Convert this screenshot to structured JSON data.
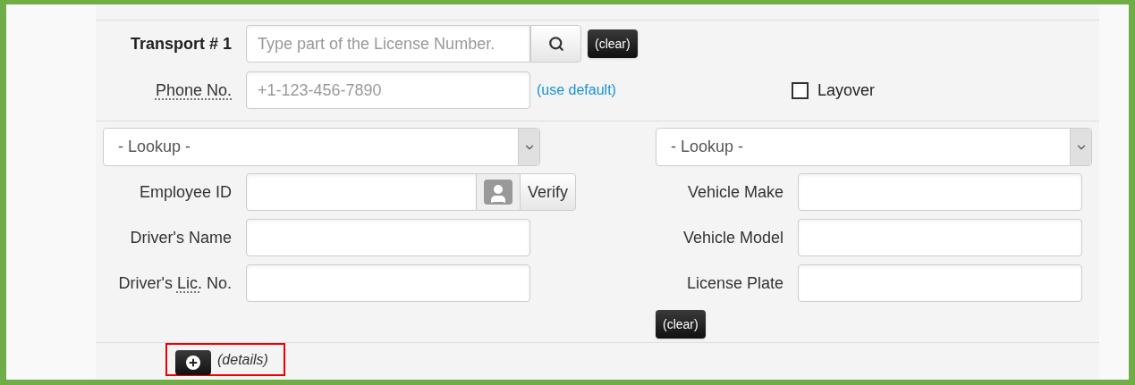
{
  "transport": {
    "label": "Transport # 1",
    "search_placeholder": "Type part of the License Number.",
    "clear": "(clear)"
  },
  "phone": {
    "label": "Phone No.",
    "placeholder": "+1-123-456-7890",
    "link": "(use default)"
  },
  "layover": {
    "label": "Layover",
    "checked": false
  },
  "driver": {
    "lookup": "- Lookup -",
    "fields": [
      {
        "kind": "verify",
        "label_parts": [
          {
            "text": "Employee ID",
            "abbr": false
          }
        ],
        "button": "Verify"
      },
      {
        "kind": "plain",
        "label_parts": [
          {
            "text": "Driver's Name",
            "abbr": false
          }
        ]
      },
      {
        "kind": "plain",
        "label_parts": [
          {
            "text": "Driver's ",
            "abbr": false
          },
          {
            "text": "Lic.",
            "abbr": true
          },
          {
            "text": " No.",
            "abbr": false
          }
        ]
      }
    ]
  },
  "vehicle": {
    "lookup": "- Lookup -",
    "fields": [
      {
        "kind": "plain",
        "label_parts": [
          {
            "text": "Vehicle Make",
            "abbr": false
          }
        ]
      },
      {
        "kind": "plain",
        "label_parts": [
          {
            "text": "Vehicle Model",
            "abbr": false
          }
        ]
      },
      {
        "kind": "plain",
        "label_parts": [
          {
            "text": "License Plate",
            "abbr": false
          }
        ]
      }
    ],
    "clear": "(clear)"
  },
  "details": {
    "label": "(details)",
    "highlighted": true
  }
}
